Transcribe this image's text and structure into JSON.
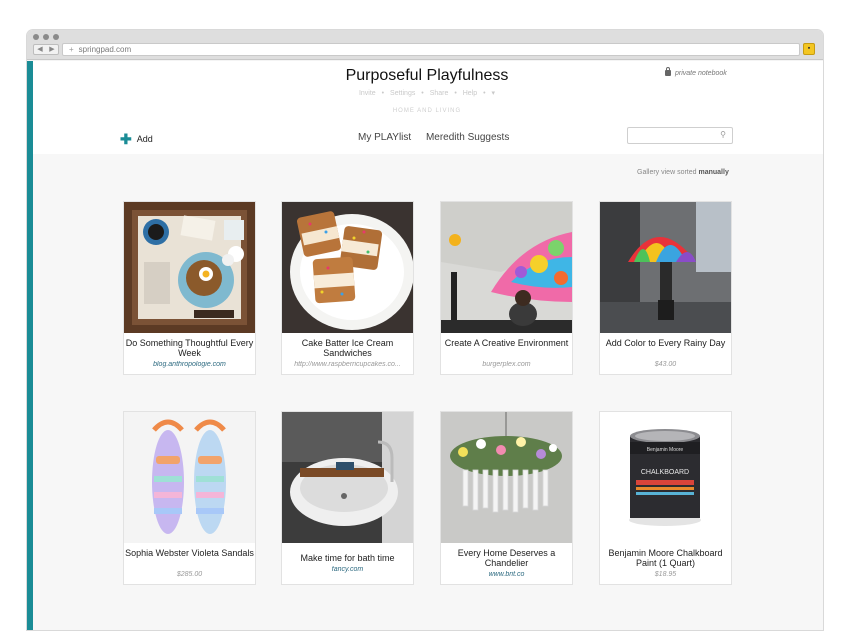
{
  "browser": {
    "url": "springpad.com",
    "url_prefix": "+",
    "nav_back": "◀",
    "nav_forward": "▶",
    "extension_icon": "puzzle-icon"
  },
  "notebook": {
    "title": "Purposeful Playfulness",
    "subnav": [
      "Invite",
      "Settings",
      "Share",
      "Help",
      "▾"
    ],
    "subnav_sep": "•",
    "breadcrumb": "HOME AND LIVING",
    "private_label": "private notebook",
    "add_label": "Add",
    "tabs": [
      "My PLAYlist",
      "Meredith Suggests"
    ],
    "search_placeholder": "",
    "gallery_view": "Gallery view",
    "sorted_label": "sorted",
    "sorted_value": "manually"
  },
  "cards": [
    {
      "title": "Do Something Thoughtful Every Week",
      "source": "blog.anthropologie.com",
      "kind": "link"
    },
    {
      "title": "Cake Batter Ice Cream Sandwiches",
      "source": "http://www.raspberricupcakes.co...",
      "kind": "url"
    },
    {
      "title": "Create A Creative Environment",
      "source": "burgerplex.com",
      "kind": "url"
    },
    {
      "title": "Add Color to Every Rainy Day",
      "source": "$43.00",
      "kind": "price"
    },
    {
      "title": "Sophia Webster Violeta Sandals",
      "source": "$285.00",
      "kind": "price"
    },
    {
      "title": "Make time for bath time",
      "source": "fancy.com",
      "kind": "link"
    },
    {
      "title": "Every Home Deserves a Chandelier",
      "source": "www.brit.co",
      "kind": "link"
    },
    {
      "title": "Benjamin Moore Chalkboard Paint (1 Quart)",
      "source": "$18.95",
      "kind": "price"
    }
  ],
  "colors": {
    "accent": "#1a8c96",
    "link": "#2d6a80"
  }
}
